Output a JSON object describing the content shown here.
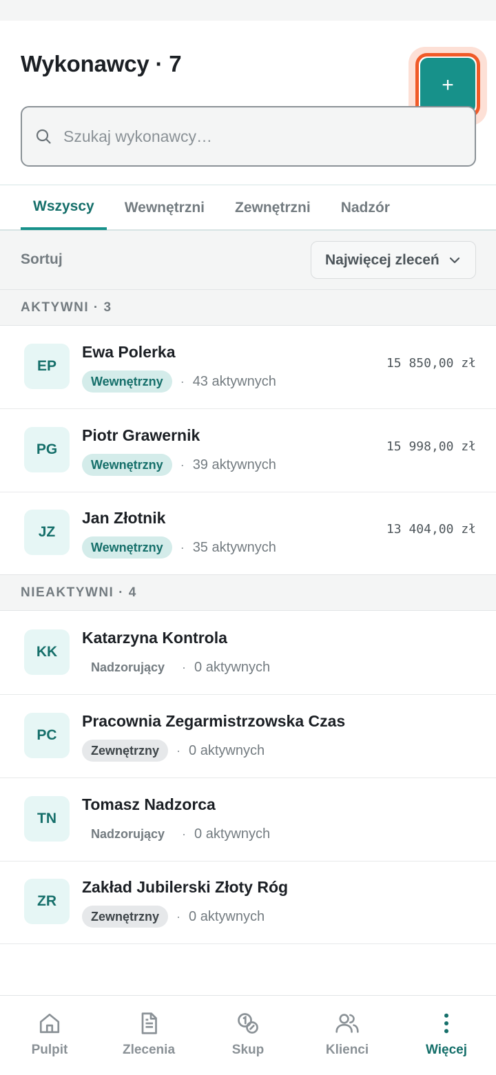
{
  "header": {
    "title": "Wykonawcy · 7",
    "add_label": "+"
  },
  "search": {
    "placeholder": "Szukaj wykonawcy…"
  },
  "tabs": [
    {
      "label": "Wszyscy",
      "active": true
    },
    {
      "label": "Wewnętrzni",
      "active": false
    },
    {
      "label": "Zewnętrzni",
      "active": false
    },
    {
      "label": "Nadzór",
      "active": false
    }
  ],
  "sort": {
    "label": "Sortuj",
    "value": "Najwięcej zleceń"
  },
  "sections": {
    "active": "AKTYWNI · 3",
    "inactive": "NIEAKTYWNI · 4"
  },
  "active_rows": [
    {
      "initials": "EP",
      "name": "Ewa Polerka",
      "badge": "Wewnętrzny",
      "dot": "·",
      "count": "43 aktywnych",
      "amount": "15 850,00 zł"
    },
    {
      "initials": "PG",
      "name": "Piotr Grawernik",
      "badge": "Wewnętrzny",
      "dot": "·",
      "count": "39 aktywnych",
      "amount": "15 998,00 zł"
    },
    {
      "initials": "JZ",
      "name": "Jan Złotnik",
      "badge": "Wewnętrzny",
      "dot": "·",
      "count": "35 aktywnych",
      "amount": "13 404,00 zł"
    }
  ],
  "inactive_rows": [
    {
      "initials": "KK",
      "name": "Katarzyna Kontrola",
      "badge": "Nadzorujący",
      "dot": "·",
      "count": "0 aktywnych"
    },
    {
      "initials": "PC",
      "name": "Pracownia Zegarmistrzowska Czas",
      "badge": "Zewnętrzny",
      "dot": "·",
      "count": "0 aktywnych"
    },
    {
      "initials": "TN",
      "name": "Tomasz Nadzorca",
      "badge": "Nadzorujący",
      "dot": "·",
      "count": "0 aktywnych"
    },
    {
      "initials": "ZR",
      "name": "Zakład Jubilerski Złoty Róg",
      "badge": "Zewnętrzny",
      "dot": "·",
      "count": "0 aktywnych"
    }
  ],
  "nav": [
    {
      "label": "Pulpit",
      "icon": "home-icon"
    },
    {
      "label": "Zlecenia",
      "icon": "document-icon"
    },
    {
      "label": "Skup",
      "icon": "coins-icon"
    },
    {
      "label": "Klienci",
      "icon": "users-icon"
    },
    {
      "label": "Więcej",
      "icon": "more-vertical-icon",
      "active": true
    }
  ],
  "colors": {
    "accent": "#17918a",
    "accent_dark": "#156f6a",
    "highlight": "#f05a28"
  }
}
